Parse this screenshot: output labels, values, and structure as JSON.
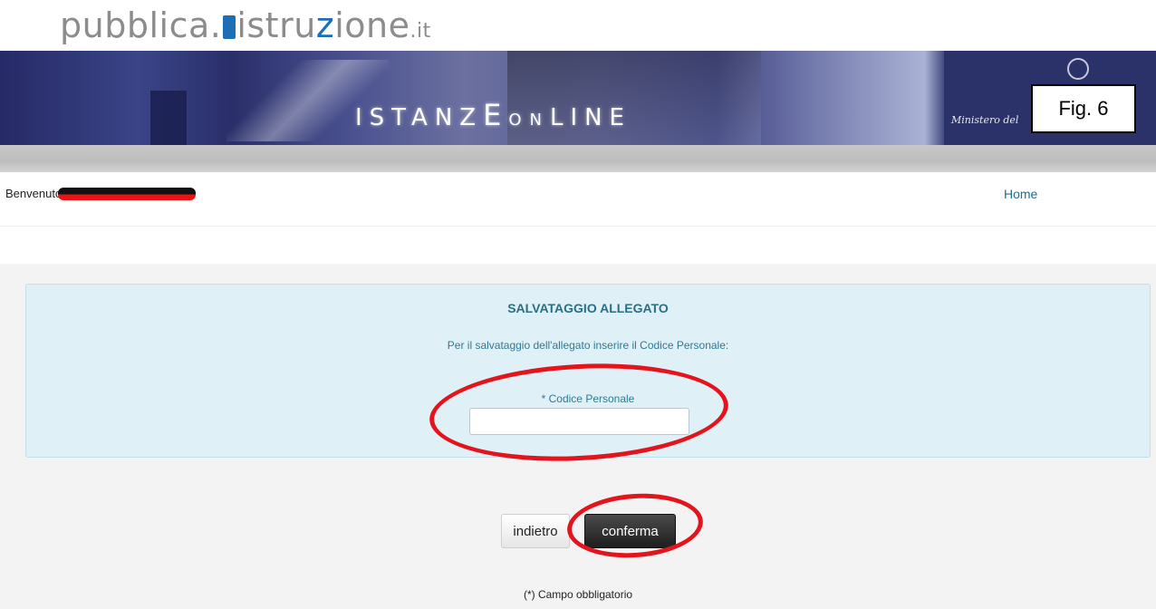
{
  "header": {
    "logo": {
      "part1": "pubblica.",
      "part2": "istru",
      "part3": "z",
      "part4": "ione",
      "tld": ".it"
    },
    "banner_title": {
      "a": "ISTANZ",
      "b": "E",
      "c": "ON",
      "d": "LINE"
    },
    "ministry_text": "Ministero del",
    "figure_label": "Fig. 6"
  },
  "nav": {
    "welcome": "Benvenuto,",
    "home_link": "Home"
  },
  "form": {
    "title": "SALVATAGGIO ALLEGATO",
    "instruction": "Per il salvataggio dell'allegato inserire il Codice Personale:",
    "field_label": "* Codice Personale",
    "field_value": "",
    "back_button": "indietro",
    "confirm_button": "conferma",
    "required_note": "(*) Campo obbligatorio"
  },
  "colors": {
    "accent_text": "#2a6f86",
    "panel_bg": "#dff0f7",
    "annotation": "#e3141b",
    "link": "#1f6f8b"
  }
}
